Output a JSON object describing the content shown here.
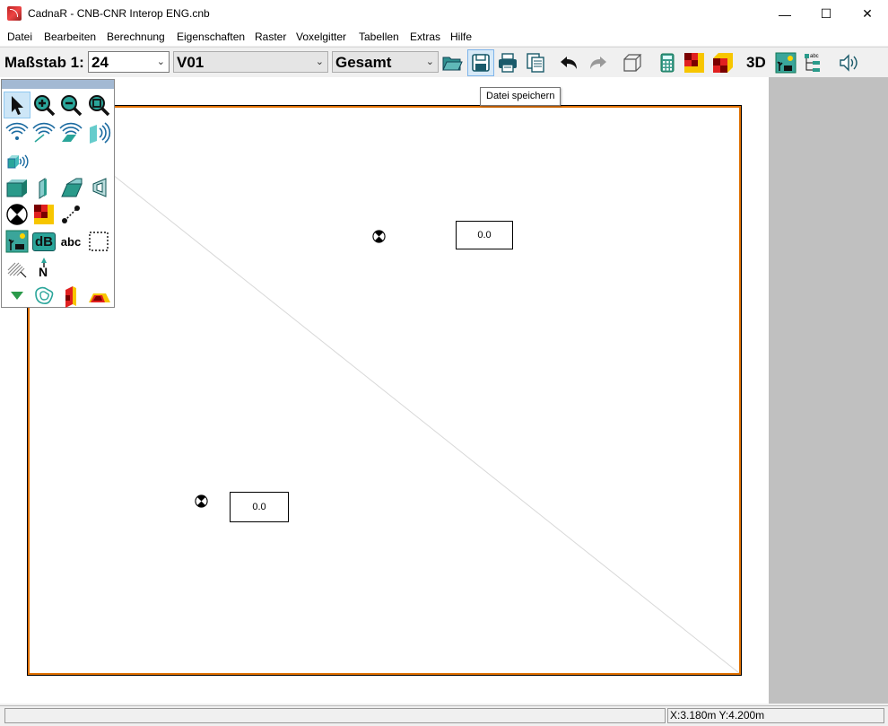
{
  "window": {
    "title": "CadnaR - CNB-CNR Interop ENG.cnb",
    "minimize": "—",
    "maximize": "☐",
    "close": "✕"
  },
  "menu": [
    "Datei",
    "Bearbeiten",
    "Berechnung",
    "Eigenschaften",
    "Raster",
    "Voxelgitter",
    "Tabellen",
    "Extras",
    "Hilfe"
  ],
  "toolbar": {
    "scale_label": "Maßstab 1:",
    "scale_value": "24",
    "variant_value": "V01",
    "level_value": "Gesamt",
    "three_d_label": "3D",
    "icons": [
      "open-folder-icon",
      "save-icon",
      "print-icon",
      "copy-page-icon",
      "undo-icon",
      "redo-icon",
      "wireframe-cube-icon",
      "calculator-icon",
      "grid-map-icon",
      "grid-map-3d-icon",
      "3d-view-icon",
      "landscape-icon",
      "tree-view-icon",
      "speaker-icon"
    ]
  },
  "tooltip": "Datei speichern",
  "drawing": {
    "receivers": [
      {
        "value": "0.0"
      },
      {
        "value": "0.0"
      }
    ],
    "frame_color": "#e07000"
  },
  "palette": {
    "items": [
      "select-arrow-icon",
      "zoom-in-icon",
      "zoom-out-icon",
      "zoom-fit-icon",
      "point-source-icon",
      "line-source-icon",
      "area-source-icon",
      "wall-source-icon",
      "box-source-icon",
      "building-icon",
      "wall-icon",
      "inclined-wall-icon",
      "barrier-icon",
      "receiver-icon",
      "grid-icon",
      "dimension-icon",
      "landscape-icon",
      "db-icon",
      "text-label",
      "selection-rect-icon",
      "hatch-icon",
      "north-arrow-icon",
      "triangle-icon",
      "contour-icon",
      "section-icon",
      "facade-icon"
    ],
    "text_label": "abc",
    "db_label": "dB",
    "north_label": "N"
  },
  "status": {
    "message": "",
    "coords": "X:3.180m Y:4.200m"
  }
}
